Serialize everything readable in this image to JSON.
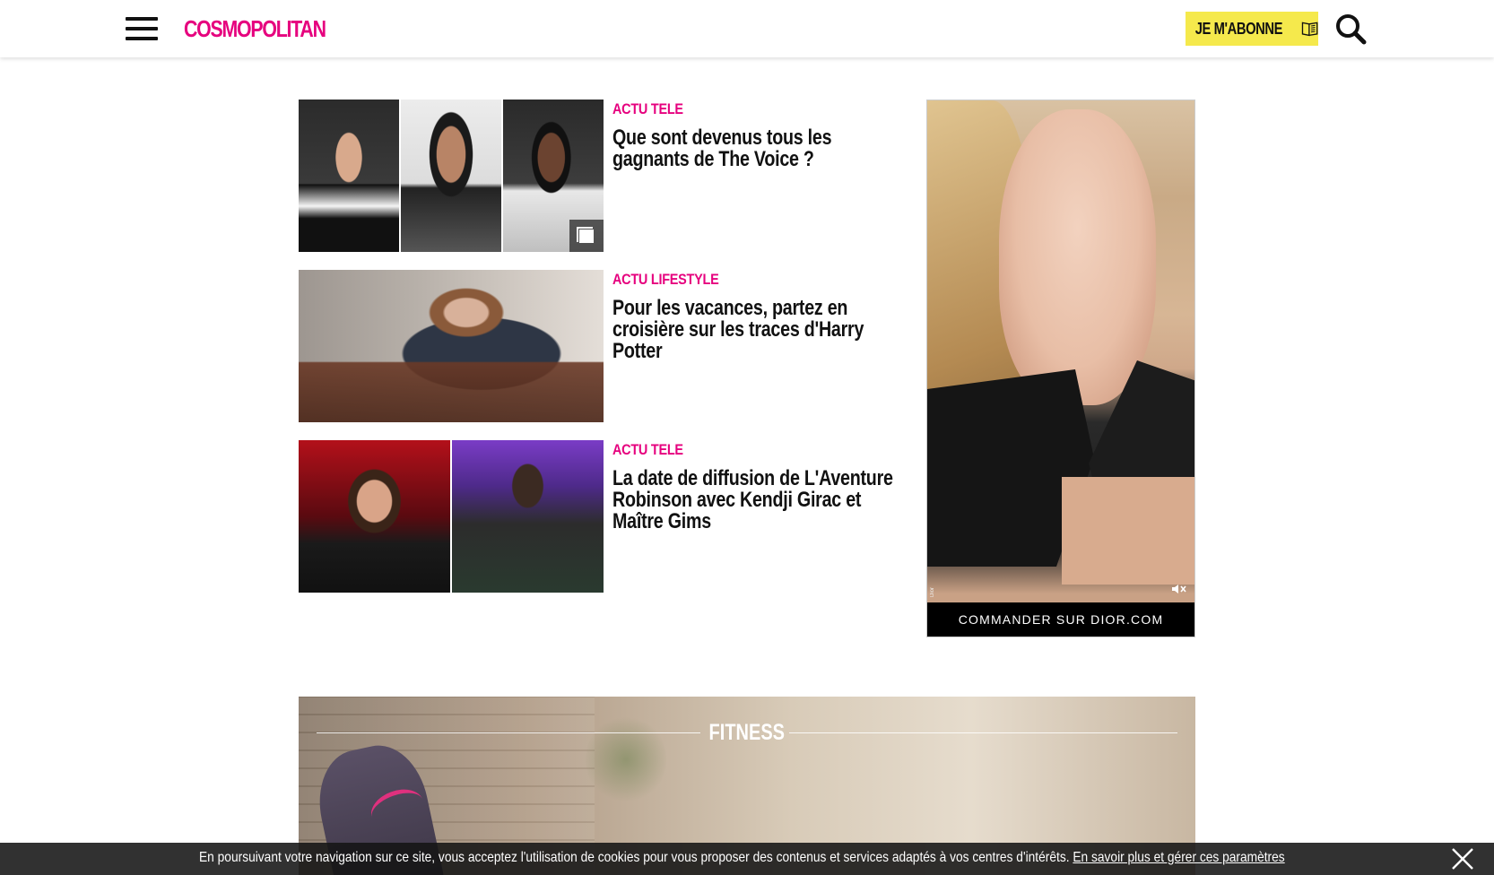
{
  "header": {
    "logo": "COSMOPOLITAN",
    "subscribe_label": "JE M'ABONNE",
    "icons": [
      "menu-icon",
      "magazine-icon",
      "search-icon"
    ]
  },
  "articles": [
    {
      "category": "ACTU TELE",
      "title": "Que sont devenus tous les gagnants de The Voice ?",
      "gallery": true
    },
    {
      "category": "ACTU LIFESTYLE",
      "title": "Pour les vacances, partez en croisière sur les traces d'Harry Potter",
      "gallery": false
    },
    {
      "category": "ACTU TELE",
      "title": "La date de diffusion de L'Aventure Robinson avec Kendji Girac et Maître Gims",
      "gallery": false
    }
  ],
  "ad": {
    "cta": "COMMANDER SUR DIOR.COM",
    "brand": "Dior",
    "icons": [
      "mute-icon"
    ]
  },
  "fitness": {
    "title": "FITNESS"
  },
  "cookie_bar": {
    "message": "En poursuivant votre navigation sur ce site, vous acceptez l'utilisation de cookies pour vous proposer des contenus et services adaptés à vos centres d'intérêts.",
    "link": "En savoir plus et gérer ces paramètres",
    "icons": [
      "close-icon"
    ]
  },
  "colors": {
    "brand_pink": "#e6007e",
    "subscribe_yellow": "#f5e94c"
  }
}
